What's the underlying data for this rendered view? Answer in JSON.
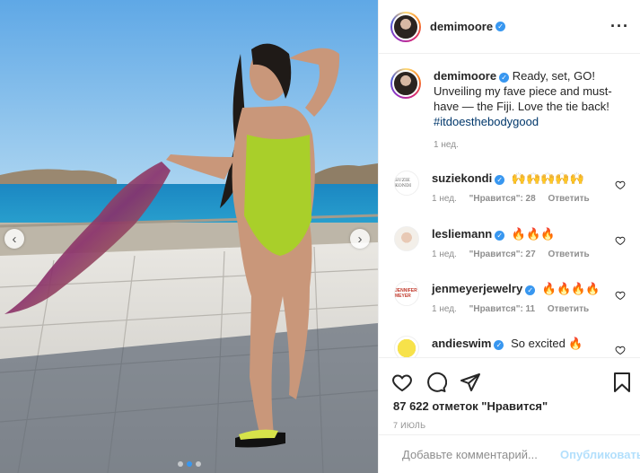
{
  "post": {
    "username": "demimoore",
    "more_icon": "more-horizontal-icon",
    "verified_icon": "verified-badge-icon"
  },
  "caption": {
    "username": "demimoore",
    "text": "Ready, set, GO! Unveiling my fave piece and must-have — the Fiji. Love the tie back!",
    "hashtag": "#itdoesthebodygood",
    "time": "1 нед."
  },
  "comments": [
    {
      "username": "suziekondi",
      "text": "🙌🙌🙌🙌🙌",
      "time": "1 нед.",
      "likes": "\"Нравится\": 28",
      "reply": "Ответить",
      "avatar_text": "SUZIE KONDI"
    },
    {
      "username": "lesliemann",
      "text": "🔥🔥🔥",
      "time": "1 нед.",
      "likes": "\"Нравится\": 27",
      "reply": "Ответить",
      "avatar_text": ""
    },
    {
      "username": "jenmeyerjewelry",
      "text": "🔥🔥🔥🔥",
      "time": "1 нед.",
      "likes": "\"Нравится\": 11",
      "reply": "Ответить",
      "avatar_text": "JENNIFER MEYER"
    },
    {
      "username": "andieswim",
      "text": "So excited 🔥",
      "time": "",
      "likes": "",
      "reply": "",
      "avatar_text": ""
    }
  ],
  "actions": {
    "icons": [
      "heart-icon",
      "comment-icon",
      "share-icon",
      "bookmark-icon"
    ],
    "likes_text": "87 622 отметок \"Нравится\"",
    "date": "7 ИЮЛЬ"
  },
  "add_comment": {
    "placeholder": "Добавьте комментарий...",
    "post_label": "Опубликовать",
    "emoji_icon": "emoji-icon"
  },
  "carousel": {
    "prev_arrow": "‹",
    "next_arrow": "›",
    "slides": 3,
    "active_slide": 2
  },
  "colors": {
    "accent": "#3897f0",
    "hashtag": "#00376b",
    "muted": "#8e8e8e",
    "post_button": "#b2dffc"
  }
}
